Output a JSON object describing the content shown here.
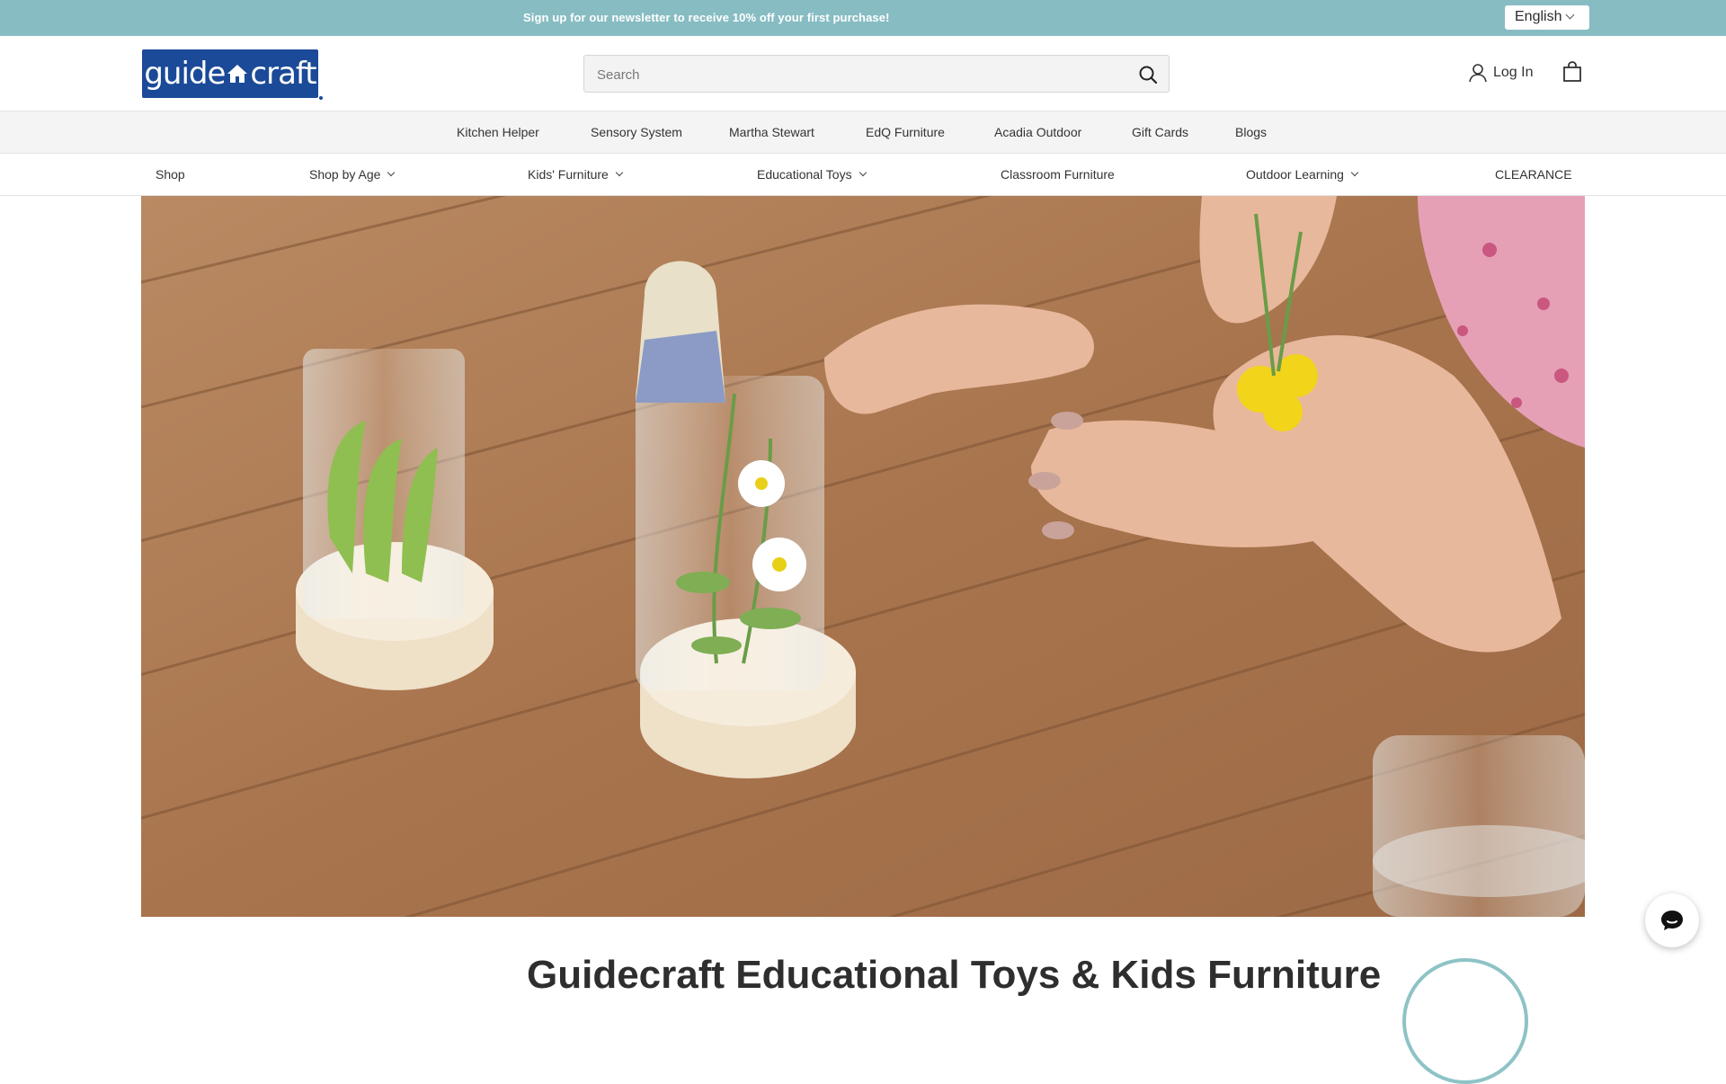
{
  "announcement": {
    "text": "Sign up for our newsletter to receive 10% off your first purchase!"
  },
  "language": {
    "selected": "English"
  },
  "header": {
    "logo_text_left": "guide",
    "logo_text_right": "craft",
    "search_placeholder": "Search",
    "login_label": "Log In"
  },
  "subnav": {
    "items": [
      {
        "label": "Kitchen Helper"
      },
      {
        "label": "Sensory System"
      },
      {
        "label": "Martha Stewart"
      },
      {
        "label": "EdQ Furniture"
      },
      {
        "label": "Acadia Outdoor"
      },
      {
        "label": "Gift Cards"
      },
      {
        "label": "Blogs"
      }
    ]
  },
  "mainnav": {
    "items": [
      {
        "label": "Shop"
      },
      {
        "label": "Shop by Age"
      },
      {
        "label": "Kids' Furniture"
      },
      {
        "label": "Educational Toys"
      },
      {
        "label": "Classroom Furniture"
      },
      {
        "label": "Outdoor Learning"
      },
      {
        "label": "CLEARANCE"
      }
    ]
  },
  "page": {
    "heading_peek": "Guidecraft Educational Toys & Kids Furniture"
  },
  "icons": {
    "search": "search-icon",
    "user": "user-icon",
    "cart": "shopping-bag-icon",
    "chat": "chat-icon"
  },
  "colors": {
    "announcement_bg": "#87bcc3",
    "logo_bg": "#1b4a98"
  }
}
